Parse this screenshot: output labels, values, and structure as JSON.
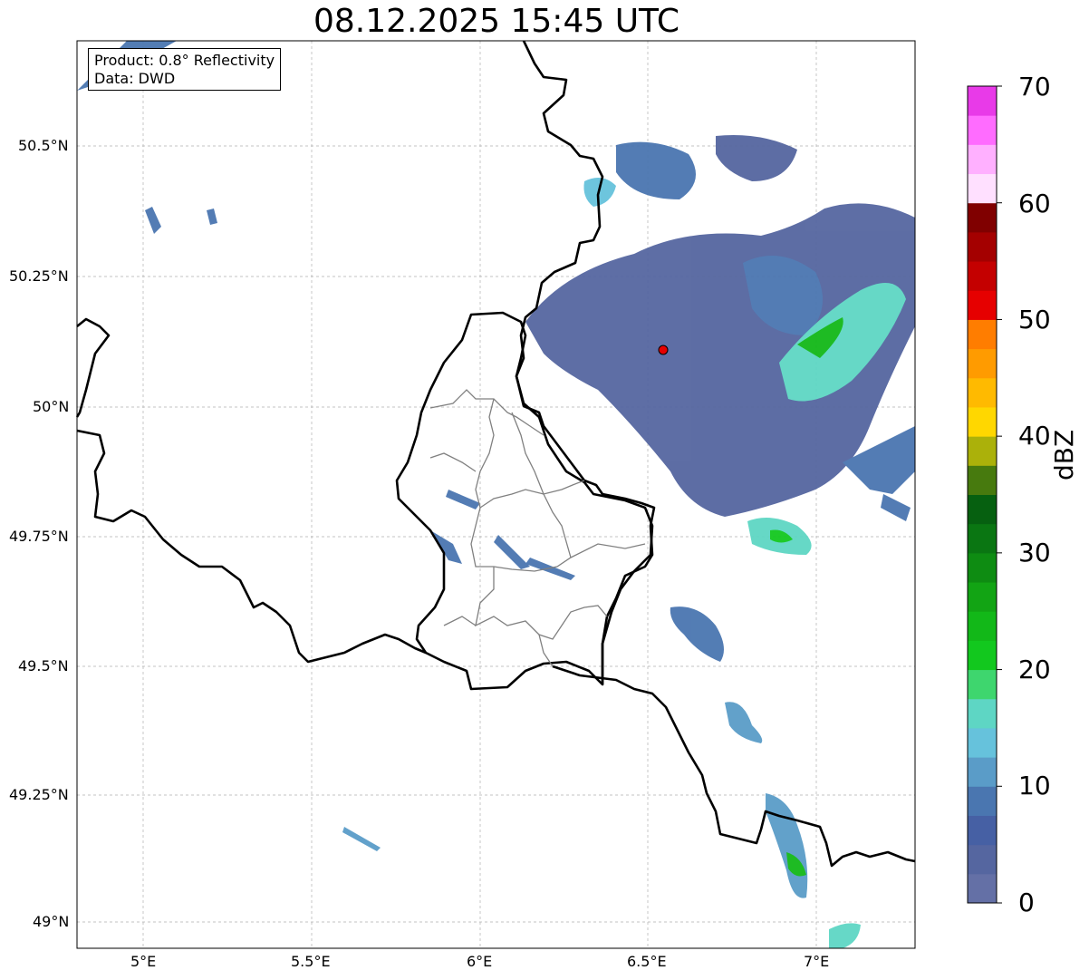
{
  "title": "08.12.2025 15:45 UTC",
  "legend": {
    "product": "Product: 0.8° Reflectivity",
    "source": "Data: DWD"
  },
  "axes": {
    "lon_ticks": [
      "5°E",
      "5.5°E",
      "6°E",
      "6.5°E",
      "7°E"
    ],
    "lat_ticks": [
      "50.5°N",
      "50.25°N",
      "50°N",
      "49.75°N",
      "49.5°N",
      "49.25°N",
      "49°N"
    ]
  },
  "colorbar": {
    "label": "dBZ",
    "ticks": [
      "70",
      "60",
      "50",
      "40",
      "30",
      "20",
      "10",
      "0"
    ],
    "min": 0,
    "max": 70,
    "step": 2.5,
    "colors": [
      "#6470a6",
      "#5566a0",
      "#4660a4",
      "#4a76b0",
      "#5a9cc8",
      "#66c2dc",
      "#5ed6c4",
      "#3ed66e",
      "#12c81e",
      "#12b818",
      "#12a414",
      "#0e8c12",
      "#0a7612",
      "#066010",
      "#477a0e",
      "#abb10a",
      "#ffd700",
      "#ffba00",
      "#ff9b00",
      "#ff7d00",
      "#e60000",
      "#c40000",
      "#a40000",
      "#800000",
      "#ffe0ff",
      "#ffb0ff",
      "#ff6cff",
      "#e83ae8"
    ]
  },
  "map": {
    "radar_site": {
      "lon": 6.55,
      "lat": 50.11,
      "color": "#e60000"
    },
    "extent": {
      "lon_min": 4.8,
      "lon_max": 7.3,
      "lat_min": 48.95,
      "lat_max": 50.7
    }
  }
}
